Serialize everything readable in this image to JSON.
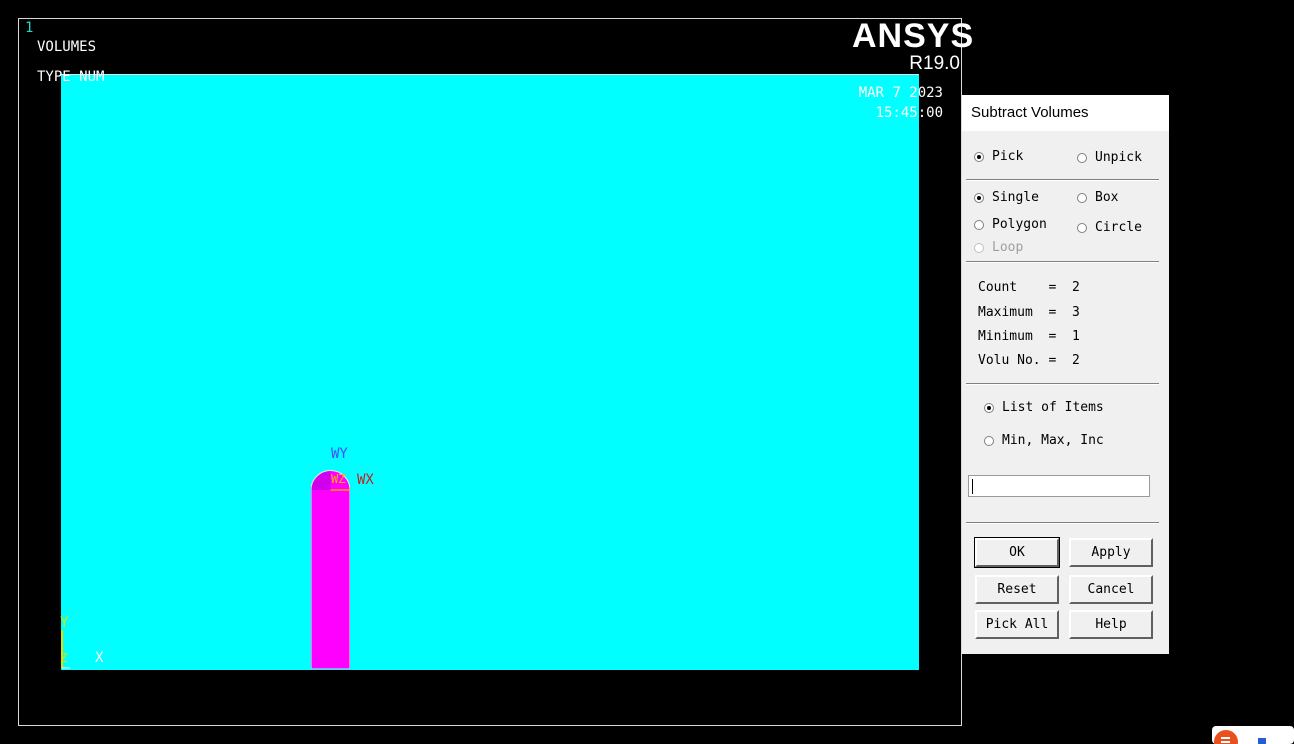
{
  "viewport": {
    "window_number": "1",
    "title": "VOLUMES",
    "subtitle": "TYPE NUM",
    "logo": "ANSYS",
    "version": "R19.0",
    "date": "MAR  7 2023",
    "time": "15:45:00",
    "background_color": "#000000",
    "model_color": "#00ffff",
    "volume_color": "#ff00ff",
    "workplane_labels": {
      "wy": "WY",
      "wx": "WX",
      "wz": "WZ"
    },
    "global_axes": {
      "y": "Y",
      "z": "Z",
      "x": "X"
    }
  },
  "dialog": {
    "title": "Subtract Volumes",
    "pick_mode": [
      {
        "label": "Pick",
        "selected": true
      },
      {
        "label": "Unpick",
        "selected": false
      }
    ],
    "pick_type": [
      {
        "label": "Single",
        "selected": true
      },
      {
        "label": "Box",
        "selected": false
      },
      {
        "label": "Polygon",
        "selected": false
      },
      {
        "label": "Circle",
        "selected": false
      },
      {
        "label": "Loop",
        "selected": false,
        "disabled": true
      }
    ],
    "stats": [
      {
        "label": "Count    =",
        "value": "2"
      },
      {
        "label": "Maximum  =",
        "value": "3"
      },
      {
        "label": "Minimum  =",
        "value": "1"
      },
      {
        "label": "Volu No. =",
        "value": "2"
      }
    ],
    "list_mode": [
      {
        "label": "List of Items",
        "selected": true
      },
      {
        "label": "Min, Max, Inc",
        "selected": false
      }
    ],
    "input_value": "",
    "buttons": {
      "ok": "OK",
      "apply": "Apply",
      "reset": "Reset",
      "cancel": "Cancel",
      "pick_all": "Pick All",
      "help": "Help"
    }
  }
}
